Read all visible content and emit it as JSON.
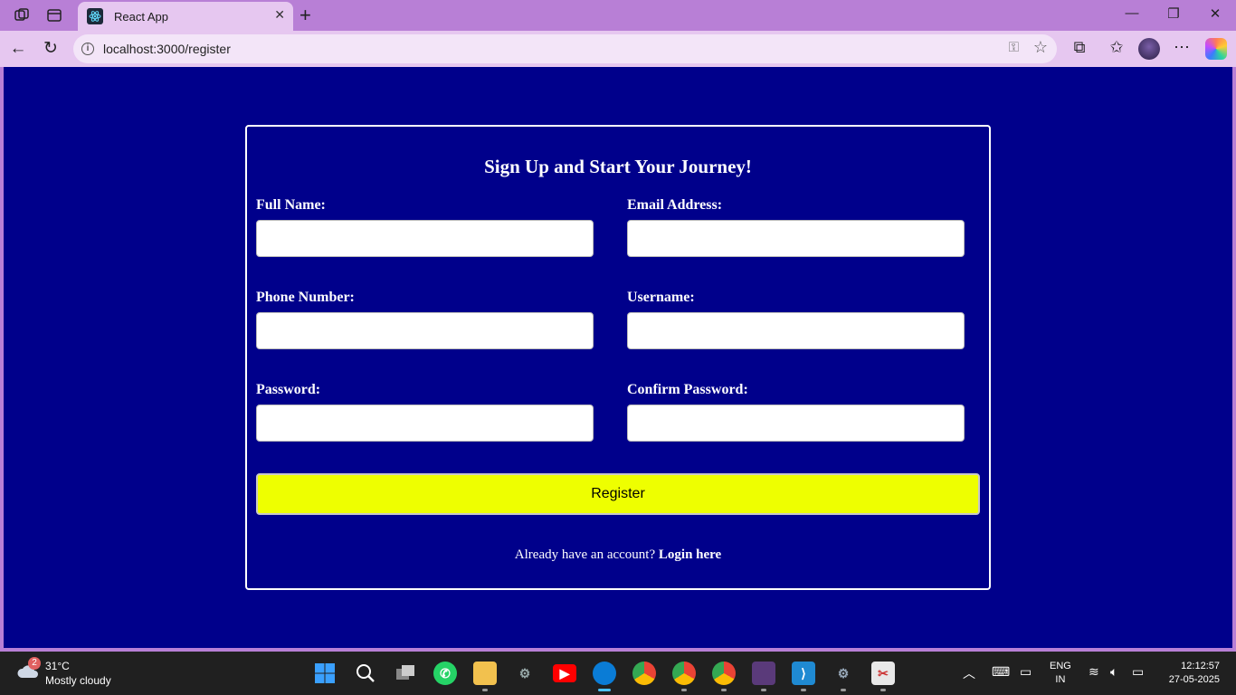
{
  "browser": {
    "tab_title": "React App",
    "url": "localhost:3000/register"
  },
  "form": {
    "heading": "Sign Up and Start Your Journey!",
    "fields": [
      {
        "label": "Full Name:",
        "value": ""
      },
      {
        "label": "Email Address:",
        "value": ""
      },
      {
        "label": "Phone Number:",
        "value": ""
      },
      {
        "label": "Username:",
        "value": ""
      },
      {
        "label": "Password:",
        "value": ""
      },
      {
        "label": "Confirm Password:",
        "value": ""
      }
    ],
    "submit_label": "Register",
    "footer_text": "Already have an account?",
    "login_link": "Login here"
  },
  "colors": {
    "page_background": "#00008b",
    "button_background": "#eeff00",
    "browser_frame": "#b87fd6"
  },
  "taskbar": {
    "weather_badge": "2",
    "temperature": "31°C",
    "weather": "Mostly cloudy",
    "lang_line1": "ENG",
    "lang_line2": "IN",
    "time": "12:12:57",
    "date": "27-05-2025"
  }
}
